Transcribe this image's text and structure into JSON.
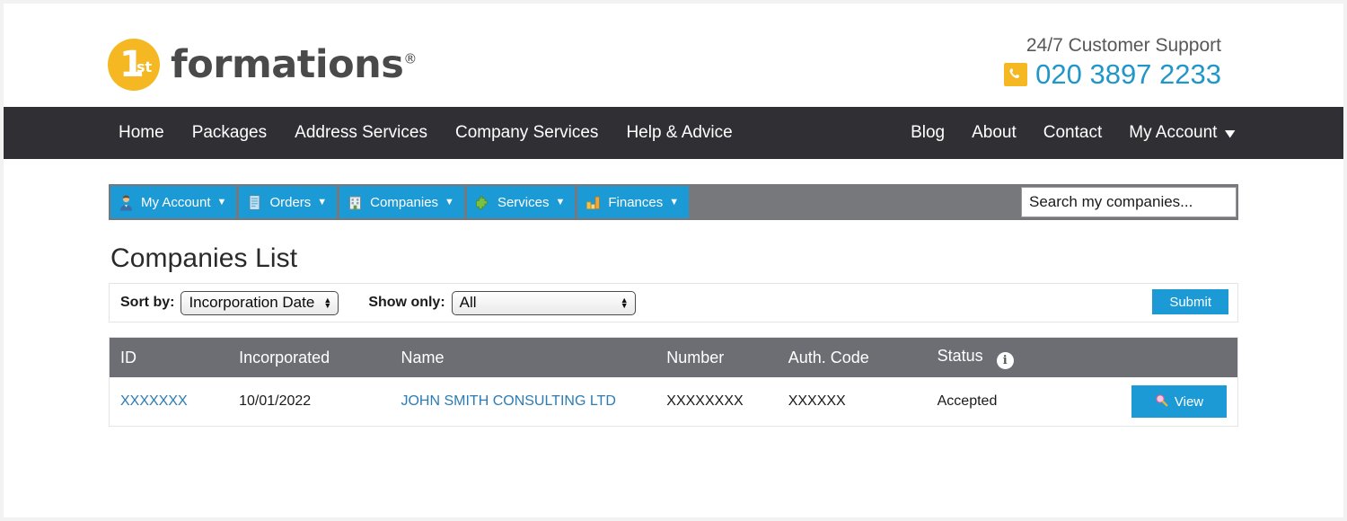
{
  "header": {
    "logo": {
      "badge_number": "1",
      "badge_suffix": "st",
      "word": "formations",
      "reg": "®"
    },
    "support_label": "24/7 Customer Support",
    "support_phone": "020 3897 2233",
    "phone_icon": "phone-icon",
    "colors": {
      "brand_yellow": "#f5b823",
      "brand_blue": "#2196c9"
    }
  },
  "nav": {
    "left": [
      {
        "label": "Home"
      },
      {
        "label": "Packages"
      },
      {
        "label": "Address Services"
      },
      {
        "label": "Company Services"
      },
      {
        "label": "Help & Advice"
      }
    ],
    "right": [
      {
        "label": "Blog"
      },
      {
        "label": "About"
      },
      {
        "label": "Contact"
      }
    ],
    "account": {
      "label": "My Account",
      "icon": "chevron-down-icon"
    },
    "bg": "#302f33"
  },
  "toolbar": {
    "tabs": [
      {
        "label": "My Account",
        "icon": "user-avatar-icon",
        "arrow": "▼"
      },
      {
        "label": "Orders",
        "icon": "document-icon",
        "arrow": "▼"
      },
      {
        "label": "Companies",
        "icon": "building-icon",
        "arrow": "▼"
      },
      {
        "label": "Services",
        "icon": "puzzle-piece-icon",
        "arrow": "▼"
      },
      {
        "label": "Finances",
        "icon": "bar-chart-icon",
        "arrow": "▼"
      }
    ],
    "search_placeholder": "Search my companies...",
    "search_value": "",
    "tab_color": "#1c9ad6",
    "bar_color": "#77787c"
  },
  "main": {
    "page_title": "Companies List",
    "filters": {
      "sort_label": "Sort by:",
      "sort_value": "Incorporation Date",
      "show_label": "Show only:",
      "show_value": "All",
      "submit_label": "Submit"
    },
    "table": {
      "columns": [
        "ID",
        "Incorporated",
        "Name",
        "Number",
        "Auth. Code",
        "Status",
        ""
      ],
      "status_info_icon": "info-icon",
      "rows": [
        {
          "id": "XXXXXXX",
          "incorporated": "10/01/2022",
          "name": "JOHN SMITH CONSULTING LTD",
          "number": "XXXXXXXX",
          "auth_code": "XXXXXX",
          "status": "Accepted",
          "action_label": "View",
          "action_icon": "magnifier-icon"
        }
      ]
    }
  }
}
